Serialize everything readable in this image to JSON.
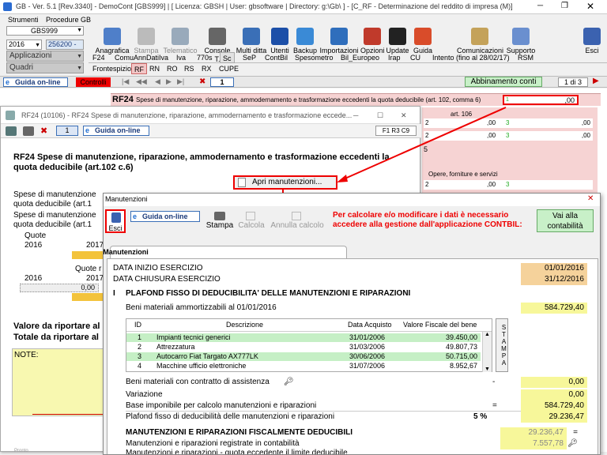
{
  "window": {
    "title": "GB - Ver. 5.1 [Rev.3340] - DemoCont [GBS999]   |  [ Licenza: GBSH | User: gbsoftware | Directory: g:\\Gb\\ ]  -  [C_RF - Determinazione del reddito di impresa (M)]"
  },
  "menu": {
    "strumenti": "Strumenti",
    "procedure": "Procedure GB"
  },
  "left": {
    "company": "GBS999",
    "year": "2016",
    "code": "256200 - ",
    "apps": "Applicazioni",
    "quadri": "Quadri"
  },
  "toolbar": {
    "anagrafica": "Anagrafica",
    "stampa": "Stampa",
    "telematico": "Telematico",
    "console": "Console T.",
    "multi": "Multi ditta",
    "utenti": "Utenti",
    "backup": "Backup",
    "importazioni": "Importazioni",
    "opzioni": "Opzioni",
    "update": "Update",
    "guida": "Guida",
    "comunicazioni": "Comunicazioni",
    "supporto": "Supporto",
    "esci": "Esci"
  },
  "tabs1": [
    "F24",
    "ComuAnnDatiIva",
    "Iva",
    "770s",
    "Sc",
    "SeP",
    "ContBil",
    "Spesometro",
    "Bil_Europeo",
    "Irap",
    "CU",
    "Intento (fino al 28/02/17)",
    "RSM"
  ],
  "tabs2": [
    "Frontespizio",
    "RF",
    "RN",
    "RO",
    "RS",
    "RX",
    "CUPE"
  ],
  "nav": {
    "guida": "Guida on-line",
    "controlli": "Controlli",
    "page": "1",
    "abbinamento": "Abbinamento conti",
    "pages": "1 di 3"
  },
  "rf_line": {
    "code": "RF24",
    "text": "Spese di manutenzione, riparazione, ammodernamento e trasformazione eccedenti la quota deducibile (art. 102, comma 6)",
    "flag": "1",
    "value": ",00"
  },
  "side": {
    "art": "art. 106",
    "n2": "2",
    "n3": "3",
    "n5": "5",
    "opere": "Opere, forniture e servizi",
    "v": ",00"
  },
  "rf24win": {
    "title": "RF24 (10106) - RF24 Spese di manutenzione, riparazione, ammodernamento e trasformazione eccede...",
    "page": "1",
    "guida": "Guida on-line",
    "code": "F1 R3 C9",
    "heading": "RF24 Spese di manutenzione, riparazione, ammodernamento e trasformazione eccedenti la quota deducibile (art.102 c.6)",
    "apri": "Apri manutenzioni...",
    "spese1": "Spese di manutenzione",
    "quota1": "quota deducibile (art.1",
    "spese2": "Spese di manutenzione",
    "quota2": "quota deducibile (art.1",
    "quote": "Quote",
    "y2016a": "2016",
    "y2017a": "2017",
    "quote_r": "Quote r",
    "y2016b": "2016",
    "y2017b": "2017",
    "zero": "0,00",
    "valore": "Valore da riportare al",
    "totale": "Totale da riportare al",
    "note": "NOTE:"
  },
  "manut": {
    "title": "Manutenzioni",
    "esci": "Esci",
    "guida": "Guida on-line",
    "stampa": "Stampa",
    "calcola": "Calcola",
    "annulla": "Annulla calcolo",
    "warning": "Per calcolare e/o modificare i dati è necessario accedere alla gestione dall'applicazione CONTBIL:",
    "vai": "Vai alla contabilità",
    "tab": "Manutenzioni",
    "inizio_label": "DATA INIZIO ESERCIZIO",
    "inizio": "01/01/2016",
    "chiusura_label": "DATA CHIUSURA ESERCIZIO",
    "chiusura": "31/12/2016",
    "sec1_num": "I",
    "sec1": "PLAFOND FISSO DI DEDUCIBILITA' DELLE MANUTENZIONI E  RIPARAZIONI",
    "beni_label": "Beni materiali ammortizzabili al 01/01/2016",
    "beni": "584.729,40",
    "cols": [
      "ID",
      "Descrizione",
      "Data Acquisto",
      "Valore Fiscale del bene"
    ],
    "stampa_col": "STAMPA",
    "rows": [
      [
        "1",
        "Impianti tecnici generici",
        "31/01/2006",
        "39.450,00"
      ],
      [
        "2",
        "Attrezzatura",
        "31/03/2006",
        "49.807,73"
      ],
      [
        "3",
        "Autocarro Fiat Targato AX777LK",
        "30/06/2006",
        "50.715,00"
      ],
      [
        "4",
        "Macchine ufficio elettroniche",
        "31/07/2006",
        "8.952,67"
      ]
    ],
    "contratto_label": "Beni materiali con contratto di assistenza",
    "contratto_sign": "-",
    "contratto": "0,00",
    "variazione_label": "Variazione",
    "variazione": "0,00",
    "base_label": "Base imponibile per calcolo manutenzioni e riparazioni",
    "base_sign": "=",
    "base": "584.729,40",
    "plafond_label": "Plafond fisso di deducibilità delle manutenzioni e riparazioni",
    "plafond_pct": "5 %",
    "plafond": "29.236,47",
    "sec2": "MANUTENZIONI E RIPARAZIONI FISCALMENTE DEDUCIBILI",
    "sec2_val": "29.236,47",
    "sec2_sign": "=",
    "registrate_label": "Manutenzioni e riparazioni registrate in contabilità",
    "registrate": "7.557,78",
    "eccedente_label": "Manutenzioni e riparazioni - quota eccedente il limite deducibile"
  },
  "status": {
    "pronto": "Pronto"
  }
}
